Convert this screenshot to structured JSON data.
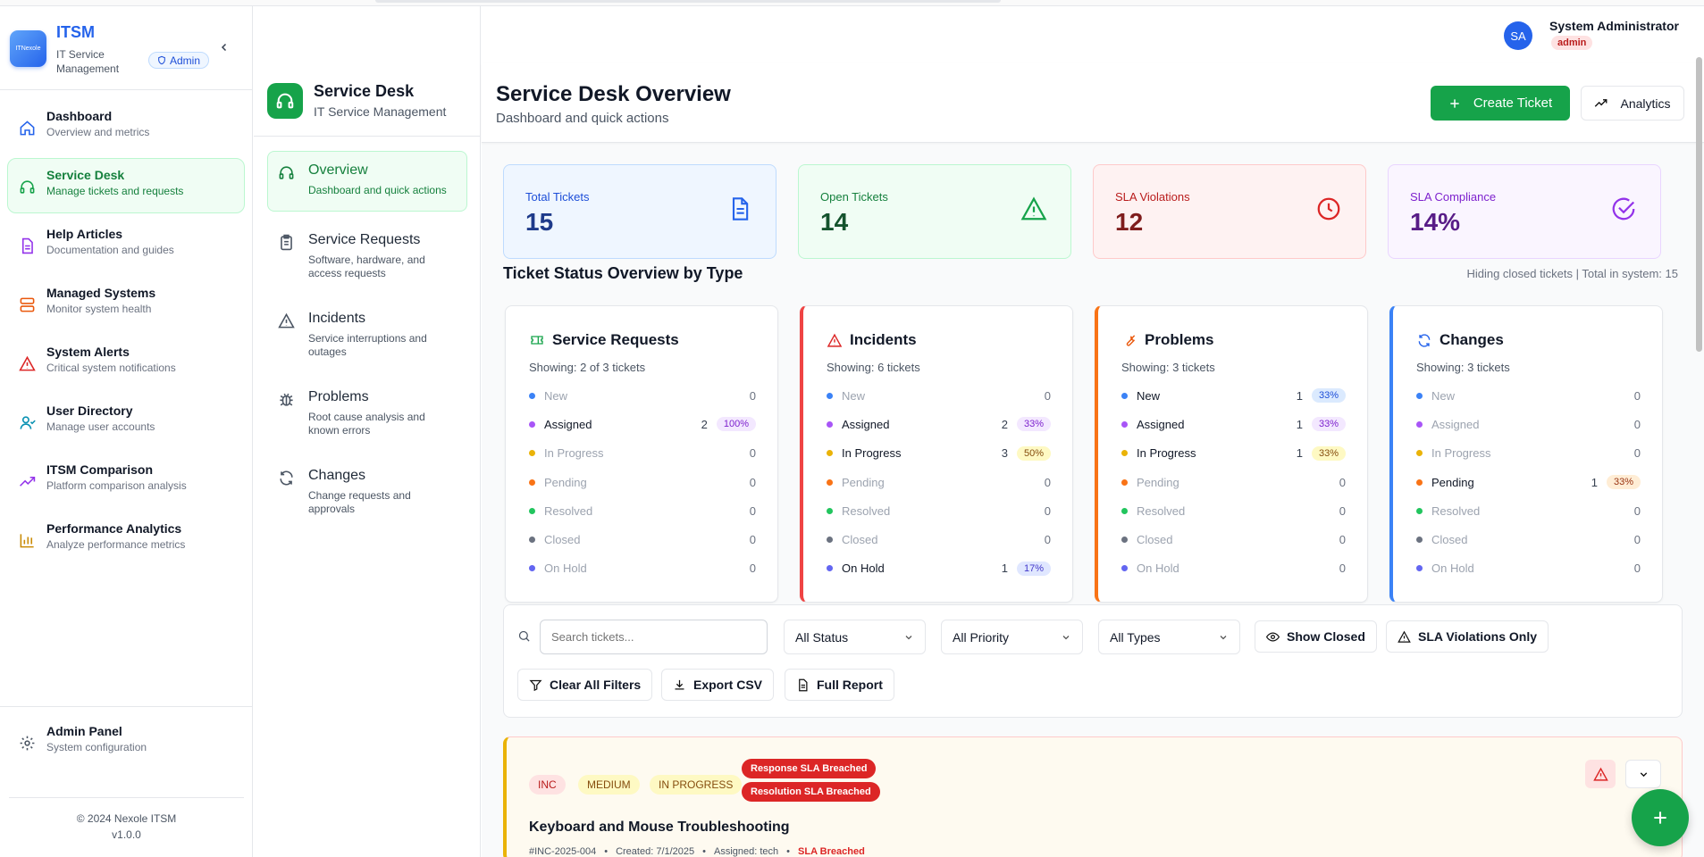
{
  "app": {
    "name": "ITSM",
    "logo_text": "ITNexole",
    "subtitle": "IT Service Management",
    "role_badge": "Admin"
  },
  "sidebar": {
    "items": [
      {
        "label": "Dashboard",
        "desc": "Overview and metrics",
        "icon": "home-icon",
        "color": "#2563eb"
      },
      {
        "label": "Service Desk",
        "desc": "Manage tickets and requests",
        "icon": "headset-icon",
        "color": "#16a34a"
      },
      {
        "label": "Help Articles",
        "desc": "Documentation and guides",
        "icon": "document-icon",
        "color": "#9333ea"
      },
      {
        "label": "Managed Systems",
        "desc": "Monitor system health",
        "icon": "server-icon",
        "color": "#ea580c"
      },
      {
        "label": "System Alerts",
        "desc": "Critical system notifications",
        "icon": "alert-triangle-icon",
        "color": "#dc2626"
      },
      {
        "label": "User Directory",
        "desc": "Manage user accounts",
        "icon": "user-icon",
        "color": "#0891b2"
      },
      {
        "label": "ITSM Comparison",
        "desc": "Platform comparison analysis",
        "icon": "trending-up-icon",
        "color": "#9333ea"
      },
      {
        "label": "Performance Analytics",
        "desc": "Analyze performance metrics",
        "icon": "bar-chart-icon",
        "color": "#ca8a04"
      }
    ],
    "admin": {
      "label": "Admin Panel",
      "desc": "System configuration",
      "icon": "gear-icon"
    },
    "footer_copyright": "© 2024 Nexole ITSM",
    "footer_version": "v1.0.0"
  },
  "subnav": {
    "title": "Service Desk",
    "desc": "IT Service Management",
    "items": [
      {
        "label": "Overview",
        "desc": "Dashboard and quick actions",
        "icon": "headset-icon"
      },
      {
        "label": "Service Requests",
        "desc": "Software, hardware, and access requests",
        "icon": "clipboard-icon"
      },
      {
        "label": "Incidents",
        "desc": "Service interruptions and outages",
        "icon": "alert-triangle-icon"
      },
      {
        "label": "Problems",
        "desc": "Root cause analysis and known errors",
        "icon": "bug-icon"
      },
      {
        "label": "Changes",
        "desc": "Change requests and approvals",
        "icon": "refresh-icon"
      }
    ]
  },
  "user": {
    "initials": "SA",
    "name": "System Administrator",
    "role": "admin"
  },
  "header": {
    "title": "Service Desk Overview",
    "subtitle": "Dashboard and quick actions",
    "create_label": "Create Ticket",
    "analytics_label": "Analytics"
  },
  "stats": [
    {
      "label": "Total Tickets",
      "value": "15"
    },
    {
      "label": "Open Tickets",
      "value": "14"
    },
    {
      "label": "SLA Violations",
      "value": "12"
    },
    {
      "label": "SLA Compliance",
      "value": "14%"
    }
  ],
  "section": {
    "title": "Ticket Status Overview by Type",
    "note": "Hiding closed tickets | Total in system: 15"
  },
  "status_names": [
    "New",
    "Assigned",
    "In Progress",
    "Pending",
    "Resolved",
    "Closed",
    "On Hold"
  ],
  "status_colors": [
    "#3b82f6",
    "#a855f7",
    "#eab308",
    "#f97316",
    "#22c55e",
    "#6b7280",
    "#6366f1"
  ],
  "type_cards": [
    {
      "title": "Service Requests",
      "showing": "Showing: 2 of 3 tickets",
      "counts": [
        "0",
        "2",
        "0",
        "0",
        "0",
        "0",
        "0"
      ],
      "pcts": [
        "",
        "100%",
        "",
        "",
        "",
        "",
        ""
      ]
    },
    {
      "title": "Incidents",
      "showing": "Showing: 6 tickets",
      "counts": [
        "0",
        "2",
        "3",
        "0",
        "0",
        "0",
        "1"
      ],
      "pcts": [
        "",
        "33%",
        "50%",
        "",
        "",
        "",
        "17%"
      ]
    },
    {
      "title": "Problems",
      "showing": "Showing: 3 tickets",
      "counts": [
        "1",
        "1",
        "1",
        "0",
        "0",
        "0",
        "0"
      ],
      "pcts": [
        "33%",
        "33%",
        "33%",
        "",
        "",
        "",
        ""
      ]
    },
    {
      "title": "Changes",
      "showing": "Showing: 3 tickets",
      "counts": [
        "0",
        "0",
        "0",
        "1",
        "0",
        "0",
        "0"
      ],
      "pcts": [
        "",
        "",
        "",
        "33%",
        "",
        "",
        ""
      ]
    }
  ],
  "filters": {
    "search_placeholder": "Search tickets...",
    "status": "All Status",
    "priority": "All Priority",
    "types": "All Types",
    "show_closed": "Show Closed",
    "sla_only": "SLA Violations Only",
    "clear": "Clear All Filters",
    "export": "Export CSV",
    "report": "Full Report"
  },
  "ticket": {
    "type": "INC",
    "priority": "MEDIUM",
    "status": "IN PROGRESS",
    "breach1": "Response SLA Breached",
    "breach2": "Resolution SLA Breached",
    "title": "Keyboard and Mouse Troubleshooting",
    "id": "#INC-2025-004",
    "created": "Created: 7/1/2025",
    "assigned": "Assigned: tech",
    "sla": "SLA Breached"
  }
}
